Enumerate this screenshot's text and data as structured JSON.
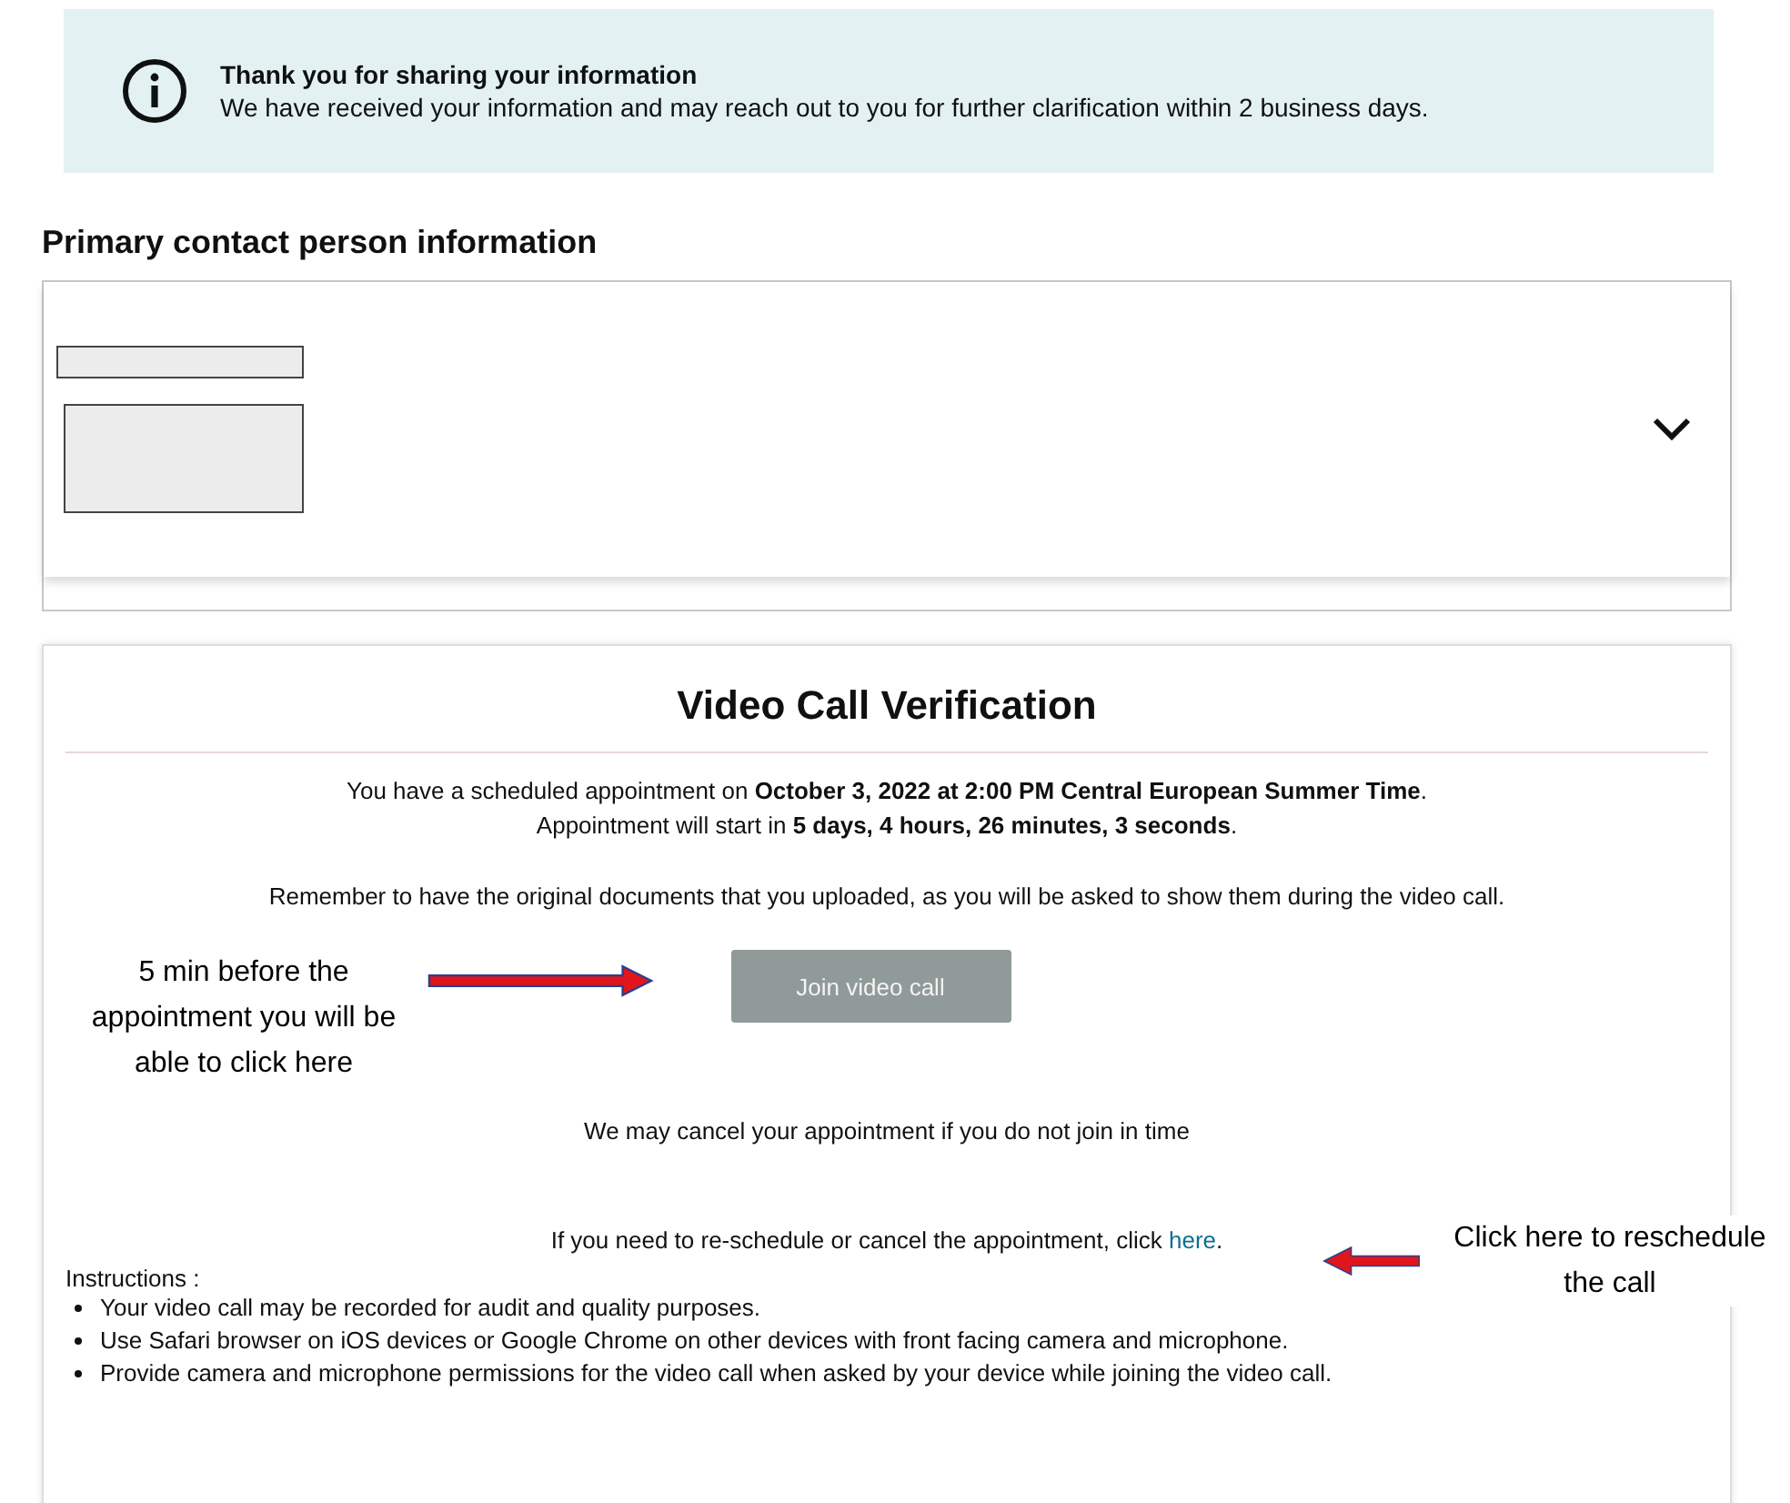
{
  "banner": {
    "title": "Thank you for sharing your information",
    "message": "We have received your information and may reach out to you for further clarification within 2 business days."
  },
  "contact": {
    "heading": "Primary contact person information",
    "expanded": false
  },
  "video_call": {
    "title": "Video Call Verification",
    "appointment": "You have a scheduled appointment on **October 3, 2022 at 2:00 PM Central European Summer Time**.",
    "countdown": "Appointment will start in **5 days, 4 hours, 26 minutes, 3 seconds**.",
    "reminder": "Remember to have the original documents that you uploaded, as you will be asked to show them during the video call.",
    "join_button": {
      "label": "Join video call",
      "disabled": true
    },
    "cancel_notice": "We may cancel your appointment if you do not join in time",
    "reschedule": {
      "text": "If you need to re-schedule or cancel the appointment, click ",
      "link": "here",
      "after": "."
    },
    "instructions_label": "Instructions :",
    "instructions": [
      "Your video call may be recorded for audit and quality purposes.",
      "Use Safari browser on iOS devices or Google Chrome on other devices with front facing camera and microphone.",
      "Provide camera and microphone permissions for the video call when asked by your device while joining the video call."
    ]
  },
  "annotations": [
    {
      "text": "5 min before the appointment you will be able to click here",
      "kind": "arrow-right"
    },
    {
      "text": "Click here to reschedule the call",
      "kind": "arrow-left"
    }
  ]
}
